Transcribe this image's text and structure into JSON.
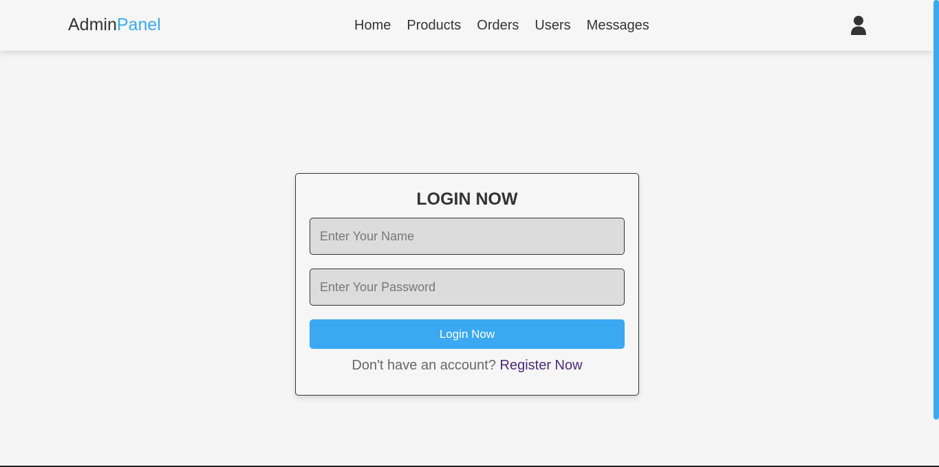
{
  "header": {
    "logo_part1": "Admin",
    "logo_part2": "Panel",
    "nav": {
      "home": "Home",
      "products": "Products",
      "orders": "Orders",
      "users": "Users",
      "messages": "Messages"
    },
    "user_icon": "user-icon"
  },
  "login_form": {
    "title": "LOGIN NOW",
    "name_placeholder": "Enter Your Name",
    "name_value": "",
    "password_placeholder": "Enter Your Password",
    "password_value": "",
    "submit_label": "Login Now",
    "register_prompt": "Don't have an account?",
    "register_link": "Register Now"
  },
  "colors": {
    "accent": "#3aa9f2",
    "background": "#f5f5f5",
    "input_background": "#dcdcdc",
    "link": "#4b2a7a",
    "text": "#333333"
  }
}
